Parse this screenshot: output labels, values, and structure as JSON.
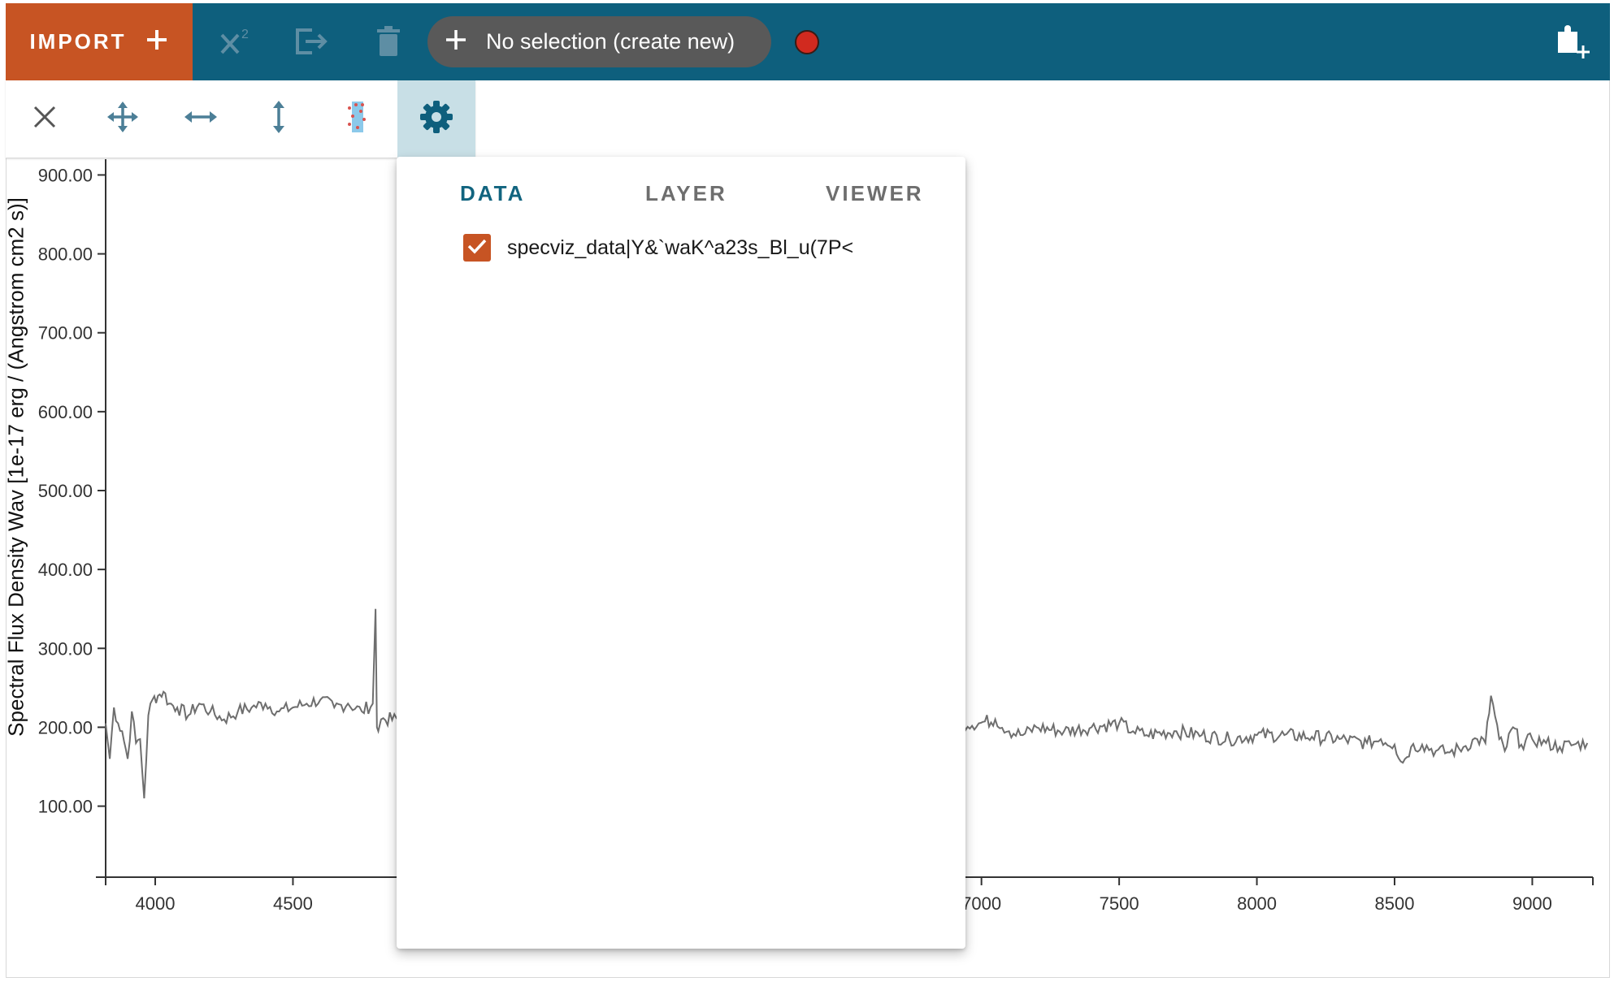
{
  "appbar": {
    "import_label": "IMPORT",
    "selection_label": "No selection (create new)",
    "icons": [
      "plus-icon",
      "chi-squared-icon",
      "export-icon",
      "delete-icon",
      "record-icon",
      "add-viewer-icon"
    ],
    "colors": {
      "bar": "#0e5f7d",
      "import": "#c75423",
      "pill": "#595959",
      "record": "#d12a1f"
    }
  },
  "toolbar": {
    "tools": [
      "close-icon",
      "pan-zoom-icon",
      "horizontal-zoom-icon",
      "vertical-zoom-icon",
      "select-data-icon",
      "settings-icon"
    ],
    "active_tool": "settings"
  },
  "popup": {
    "tabs": [
      "DATA",
      "LAYER",
      "VIEWER"
    ],
    "active_tab": "DATA",
    "items": [
      {
        "label": "specviz_data|Y&`waK^a23s_Bl_u(7P<",
        "checked": true
      }
    ]
  },
  "chart_data": {
    "type": "line",
    "title": "",
    "xlabel": "",
    "ylabel": "Spectral Flux Density Wav [1e-17 erg / (Angstrom cm2 s)]",
    "xlim": [
      3820,
      9220
    ],
    "ylim": [
      10,
      920
    ],
    "x_ticks": [
      4000,
      4500,
      7000,
      7500,
      8000,
      8500,
      9000
    ],
    "x_tick_labels": [
      "4000",
      "4500",
      "7000",
      "7500",
      "8000",
      "8500",
      "9000"
    ],
    "y_ticks": [
      100,
      200,
      300,
      400,
      500,
      600,
      700,
      800,
      900
    ],
    "y_tick_labels": [
      "100.00",
      "200.00",
      "300.00",
      "400.00",
      "500.00",
      "600.00",
      "700.00",
      "800.00",
      "900.00"
    ],
    "series": [
      {
        "color": "#6e6e6e",
        "x": [
          3820,
          3835,
          3850,
          3865,
          3880,
          3900,
          3915,
          3930,
          3945,
          3960,
          3975,
          3990,
          4010,
          4030,
          4050,
          4080,
          4120,
          4160,
          4200,
          4250,
          4300,
          4350,
          4400,
          4450,
          4500,
          4550,
          4600,
          4650,
          4700,
          4750,
          4790,
          4800,
          4805,
          4810,
          4820,
          6990,
          7050,
          7100,
          7150,
          7200,
          7300,
          7400,
          7500,
          7550,
          7600,
          7700,
          7800,
          7900,
          8000,
          8100,
          8200,
          8300,
          8400,
          8450,
          8500,
          8530,
          8560,
          8600,
          8650,
          8700,
          8750,
          8800,
          8830,
          8850,
          8880,
          8900,
          8930,
          8960,
          9000,
          9050,
          9100,
          9150,
          9200
        ],
        "y": [
          205,
          160,
          225,
          205,
          195,
          160,
          220,
          180,
          185,
          110,
          215,
          235,
          240,
          245,
          230,
          225,
          215,
          230,
          220,
          210,
          220,
          225,
          230,
          220,
          225,
          230,
          235,
          225,
          230,
          220,
          230,
          350,
          200,
          195,
          210,
          205,
          210,
          195,
          190,
          200,
          195,
          200,
          205,
          195,
          190,
          195,
          190,
          185,
          190,
          190,
          188,
          185,
          180,
          185,
          178,
          155,
          175,
          178,
          170,
          168,
          175,
          185,
          180,
          240,
          185,
          170,
          200,
          178,
          185,
          180,
          175,
          178,
          180
        ]
      }
    ],
    "grid": false,
    "legend": "none"
  }
}
